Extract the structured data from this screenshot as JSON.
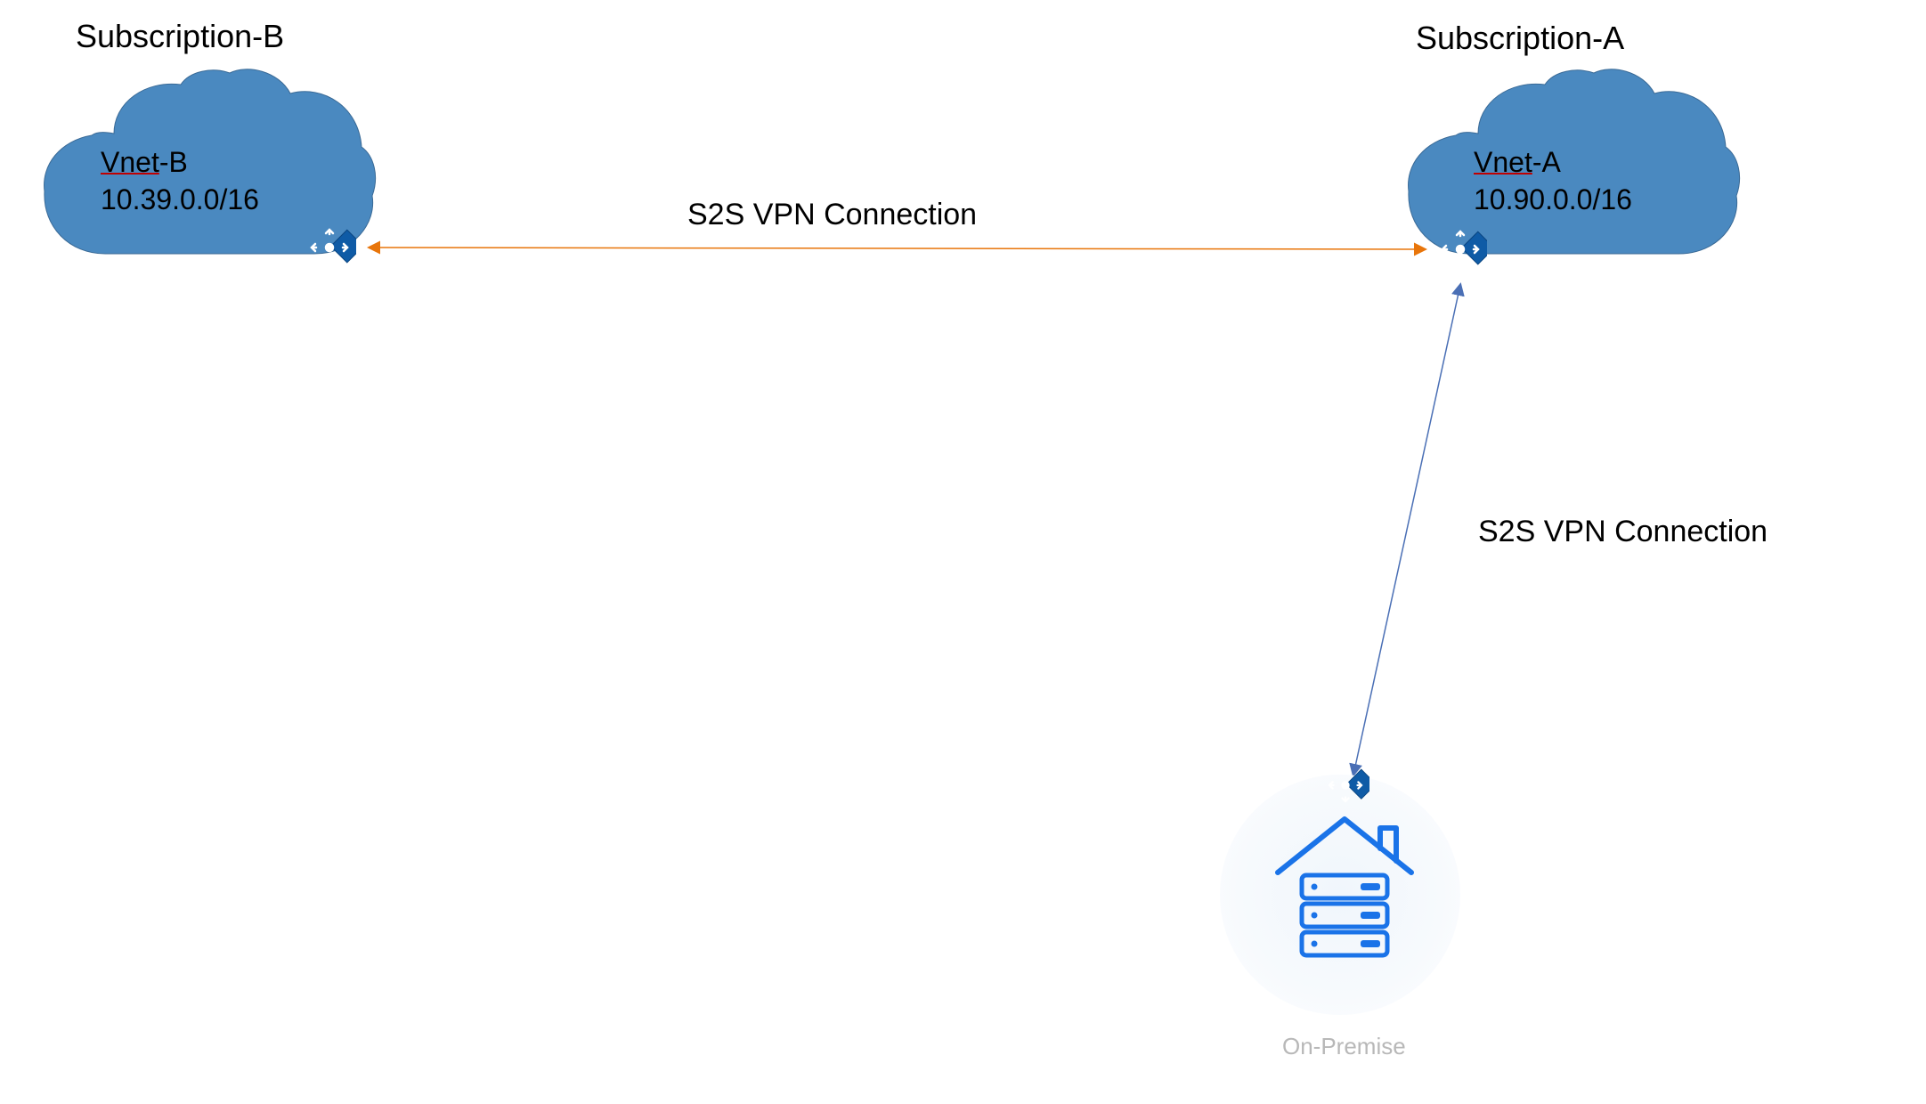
{
  "subscriptionB": {
    "label": "Subscription-B",
    "vnet": {
      "name": "Vnet",
      "suffix": "-B",
      "cidr": "10.39.0.0/16"
    }
  },
  "subscriptionA": {
    "label": "Subscription-A",
    "vnet": {
      "name": "Vnet",
      "suffix": "-A",
      "cidr": "10.90.0.0/16"
    }
  },
  "connection1": {
    "label": "S2S VPN Connection"
  },
  "connection2": {
    "label": "S2S VPN Connection"
  },
  "onpremise": {
    "label": "On-Premise"
  },
  "colors": {
    "cloud": "#4a89c0",
    "gateway": "#0f5ba6",
    "onpremIcon": "#1a73e8",
    "connectionOrange": "#e8750a",
    "connectionBlue": "#4a6fb5"
  }
}
